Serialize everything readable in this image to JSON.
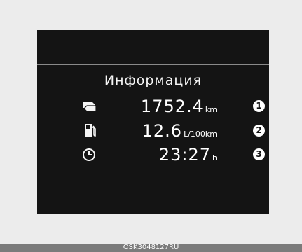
{
  "display": {
    "title": "Информация",
    "rows": [
      {
        "icon": "distance-to-empty-icon",
        "value": "1752.4",
        "unit": "km",
        "marker": "1"
      },
      {
        "icon": "fuel-pump-icon",
        "value": "12.6",
        "unit": "L/100km",
        "marker": "2"
      },
      {
        "icon": "clock-icon",
        "value": "23:27",
        "unit": "h",
        "marker": "3"
      }
    ]
  },
  "caption": "OSK3048127RU",
  "colors": {
    "screen": "#141414",
    "text": "#ffffff",
    "caption_bar": "#7b7b7b"
  }
}
